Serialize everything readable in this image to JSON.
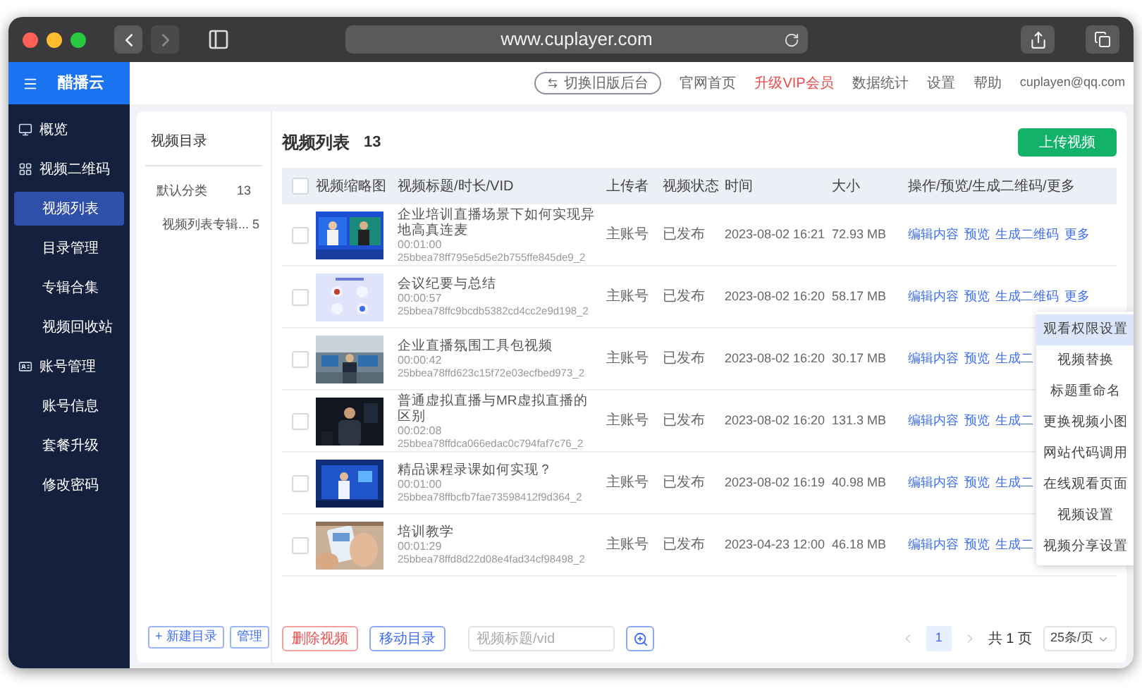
{
  "browser": {
    "url": "www.cuplayer.com"
  },
  "brand": "醋播云",
  "sidebar": {
    "items": [
      {
        "label": "概览",
        "selected": false
      },
      {
        "label": "视频二维码",
        "selected": false,
        "children": [
          {
            "label": "视频列表",
            "selected": true
          },
          {
            "label": "目录管理",
            "selected": false
          },
          {
            "label": "专辑合集",
            "selected": false
          },
          {
            "label": "视频回收站",
            "selected": false
          }
        ]
      },
      {
        "label": "账号管理",
        "selected": false,
        "children": [
          {
            "label": "账号信息",
            "selected": false
          },
          {
            "label": "套餐升级",
            "selected": false
          },
          {
            "label": "修改密码",
            "selected": false
          }
        ]
      }
    ]
  },
  "topbar": {
    "switch_button": "切换旧版后台",
    "links": [
      {
        "label": "官网首页",
        "kind": "normal"
      },
      {
        "label": "升级VIP会员",
        "kind": "highlight"
      },
      {
        "label": "数据统计",
        "kind": "normal"
      },
      {
        "label": "设置",
        "kind": "normal"
      },
      {
        "label": "帮助",
        "kind": "normal"
      }
    ],
    "account": "cuplayen@qq.com"
  },
  "catalog": {
    "title": "视频目录",
    "items": [
      {
        "label": "默认分类",
        "count": "13",
        "children": [
          {
            "label": "视频列表专辑...",
            "count": "5"
          }
        ]
      }
    ],
    "new_button": "+ 新建目录",
    "manage_button": "管理"
  },
  "list": {
    "title": "视频列表",
    "count": "13",
    "upload_button": "上传视频",
    "all_checked": false,
    "columns": [
      "视频缩略图",
      "视频标题/时长/VID",
      "上传者",
      "视频状态",
      "时间",
      "大小",
      "操作/预览/生成二维码/更多"
    ],
    "rows": [
      {
        "checked": false,
        "title": "企业培训直播场景下如何实现异地高真连麦",
        "duration": "00:01:00",
        "vid": "25bbea78ff795e5d5e2b755ffe845de9_2",
        "uploader": "主账号",
        "status": "已发布",
        "time": "2023-08-02 16:21",
        "size": "72.93 MB",
        "actions": [
          "编辑内容",
          "预览",
          "生成二维码",
          "更多"
        ]
      },
      {
        "checked": false,
        "title": "会议纪要与总结",
        "duration": "00:00:57",
        "vid": "25bbea78ffc9bcdb5382cd4cc2e9d198_2",
        "uploader": "主账号",
        "status": "已发布",
        "time": "2023-08-02 16:20",
        "size": "58.17 MB",
        "actions": [
          "编辑内容",
          "预览",
          "生成二维码",
          "更多"
        ],
        "menu": [
          {
            "label": "观看权限设置",
            "selected": true
          },
          {
            "label": "视频替换",
            "selected": false
          },
          {
            "label": "标题重命名",
            "selected": false
          },
          {
            "label": "更换视频小图",
            "selected": false
          },
          {
            "label": "网站代码调用",
            "selected": false
          },
          {
            "label": "在线观看页面",
            "selected": false
          },
          {
            "label": "视频设置",
            "selected": false
          },
          {
            "label": "视频分享设置",
            "selected": false
          }
        ]
      },
      {
        "checked": false,
        "title": "企业直播氛围工具包视频",
        "duration": "00:00:42",
        "vid": "25bbea78ffd623c15f72e03ecfbed973_2",
        "uploader": "主账号",
        "status": "已发布",
        "time": "2023-08-02 16:20",
        "size": "30.17 MB",
        "actions": [
          "编辑内容",
          "预览",
          "生成二"
        ]
      },
      {
        "checked": false,
        "title": "普通虚拟直播与MR虚拟直播的区别",
        "duration": "00:02:08",
        "vid": "25bbea78ffdca066edac0c794faf7c76_2",
        "uploader": "主账号",
        "status": "已发布",
        "time": "2023-08-02 16:20",
        "size": "131.3 MB",
        "actions": [
          "编辑内容",
          "预览",
          "生成二"
        ]
      },
      {
        "checked": false,
        "title": "精品课程录课如何实现？",
        "duration": "00:01:00",
        "vid": "25bbea78ffbcfb7fae73598412f9d364_2",
        "uploader": "主账号",
        "status": "已发布",
        "time": "2023-08-02 16:19",
        "size": "40.98 MB",
        "actions": [
          "编辑内容",
          "预览",
          "生成二"
        ]
      },
      {
        "checked": false,
        "title": "培训教学",
        "duration": "00:01:29",
        "vid": "25bbea78ffd8d22d08e4fad34cf98498_2",
        "uploader": "主账号",
        "status": "已发布",
        "time": "2023-04-23 12:00",
        "size": "46.18 MB",
        "actions": [
          "编辑内容",
          "预览",
          "生成二"
        ]
      }
    ]
  },
  "footer": {
    "delete_button": "删除视频",
    "move_button": "移动目录",
    "search": {
      "placeholder": "视频标题/vid"
    },
    "pages": [
      {
        "label": "1",
        "selected": true
      }
    ],
    "total": "共 1 页",
    "page_size": "25条/页"
  }
}
